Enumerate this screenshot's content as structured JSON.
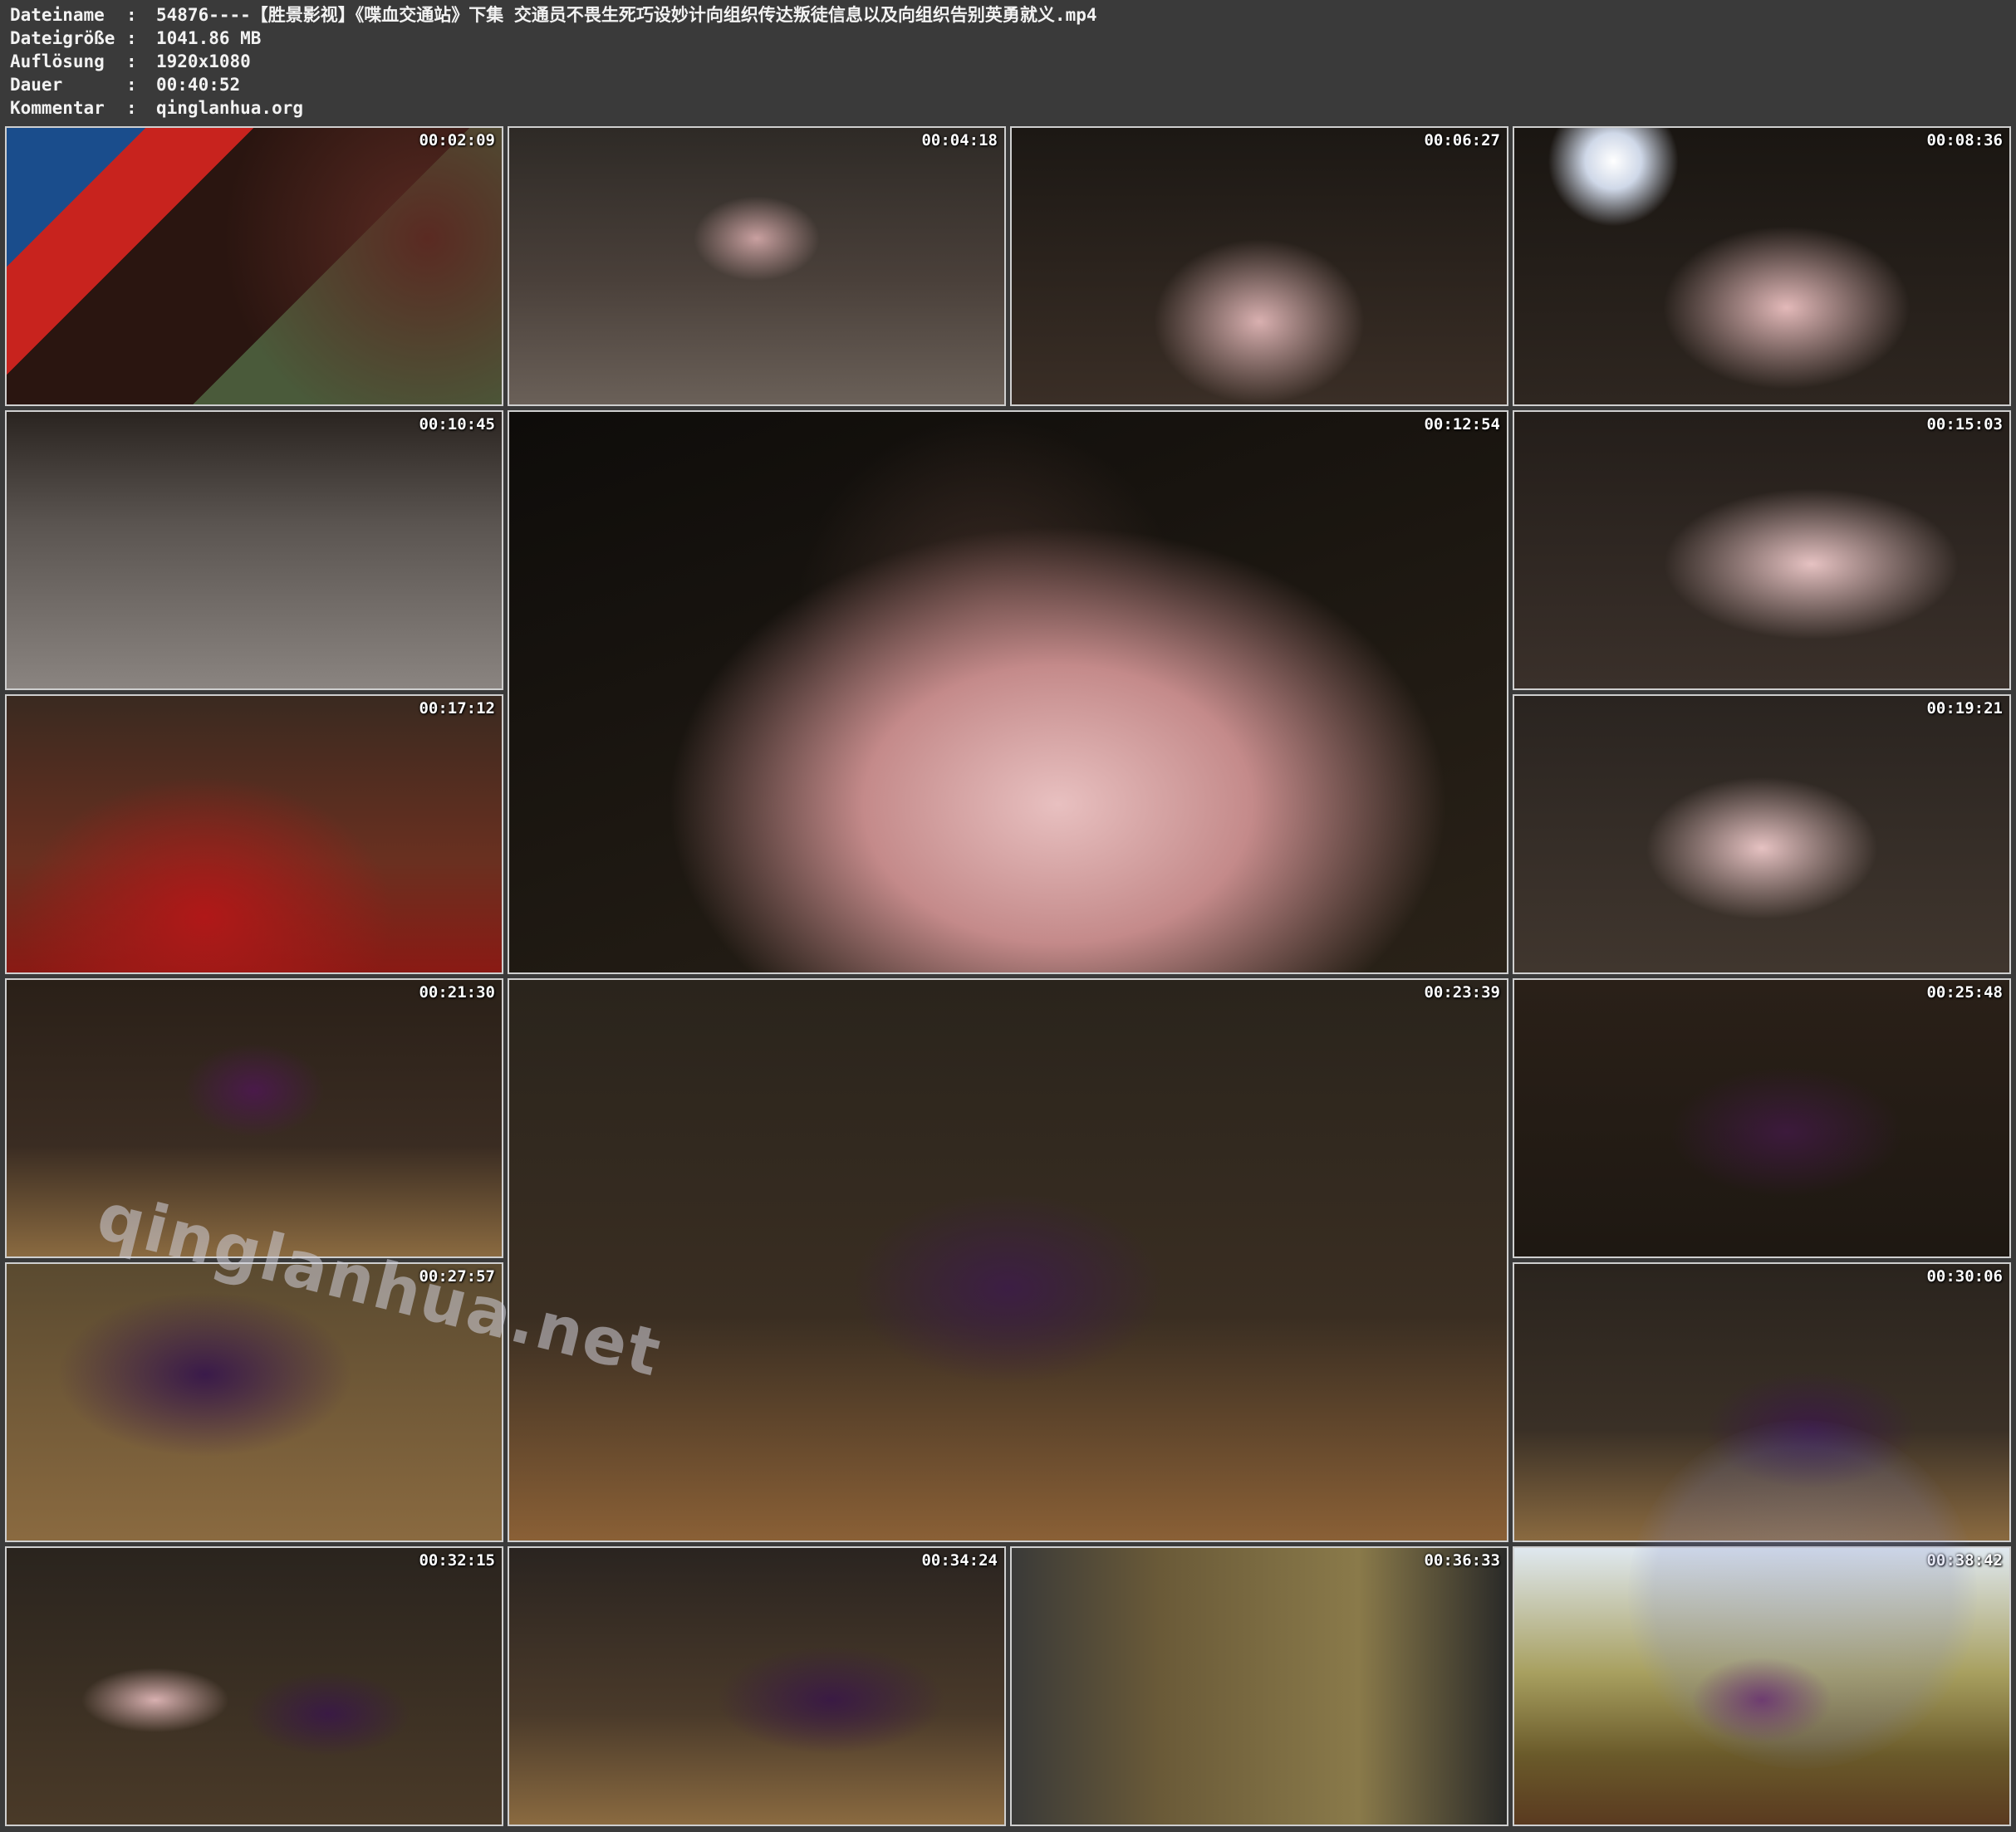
{
  "metadata": {
    "rows": [
      {
        "key": "Dateiname",
        "sep": ":",
        "value": "54876----【胜景影视】《喋血交通站》下集 交通员不畏生死巧设妙计向组织传达叛徒信息以及向组织告别英勇就义.mp4"
      },
      {
        "key": "Dateigröße",
        "sep": ":",
        "value": "1041.86 MB"
      },
      {
        "key": "Auflösung",
        "sep": ":",
        "value": "1920x1080"
      },
      {
        "key": "Dauer",
        "sep": ":",
        "value": "00:40:52"
      },
      {
        "key": "Kommentar",
        "sep": ":",
        "value": "qinglanhua.org"
      }
    ]
  },
  "thumbnails": [
    {
      "time": "00:02:09",
      "scene": "flag-desk"
    },
    {
      "time": "00:04:18",
      "scene": "dungeon-wide"
    },
    {
      "time": "00:06:27",
      "scene": "low-angle-frame"
    },
    {
      "time": "00:08:36",
      "scene": "light-frame"
    },
    {
      "time": "00:10:45",
      "scene": "floor-feet"
    },
    {
      "time": "00:12:54",
      "scene": "closeup"
    },
    {
      "time": "00:15:03",
      "scene": "seated-chair"
    },
    {
      "time": "00:17:12",
      "scene": "red-floor"
    },
    {
      "time": "00:19:21",
      "scene": "seated-cross"
    },
    {
      "time": "00:21:30",
      "scene": "cell-sitting"
    },
    {
      "time": "00:23:39",
      "scene": "straw-big"
    },
    {
      "time": "00:25:48",
      "scene": "dark-portrait"
    },
    {
      "time": "00:27:57",
      "scene": "lying-straw"
    },
    {
      "time": "00:30:06",
      "scene": "cell-corner"
    },
    {
      "time": "00:32:15",
      "scene": "two-sitting"
    },
    {
      "time": "00:34:24",
      "scene": "two-cell"
    },
    {
      "time": "00:36:33",
      "scene": "soldiers"
    },
    {
      "time": "00:38:42",
      "scene": "outdoor-pair"
    }
  ],
  "watermark": "qinglanhua.net",
  "colors": {
    "background": "#3a3a3a",
    "text": "#f2f2f2",
    "border": "#cfcfcf"
  }
}
